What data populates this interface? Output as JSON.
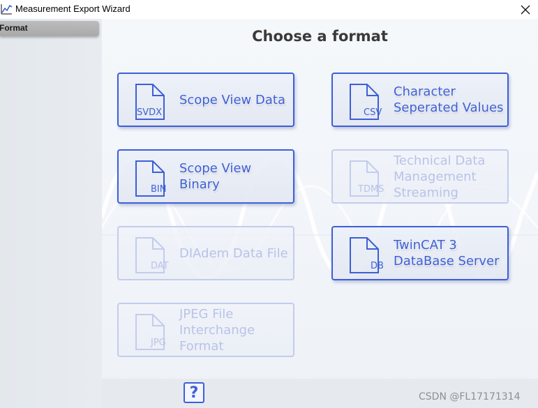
{
  "window": {
    "title": "Measurement Export Wizard",
    "app_icon": "chart-line-icon",
    "close_icon": "close-icon"
  },
  "sidebar": {
    "items": [
      {
        "label": "Format",
        "selected": true
      }
    ]
  },
  "main": {
    "heading": "Choose a format",
    "formats": [
      {
        "ext": "SVDX",
        "label": "Scope View Data",
        "enabled": true,
        "icon": "document-icon"
      },
      {
        "ext": "CSV",
        "label": "Character\nSeperated Values",
        "enabled": true,
        "icon": "document-icon"
      },
      {
        "ext": "BIN",
        "label": "Scope View Binary",
        "enabled": true,
        "icon": "document-icon"
      },
      {
        "ext": "TDMS",
        "label": "Technical Data\nManagement\nStreaming",
        "enabled": false,
        "icon": "document-icon"
      },
      {
        "ext": "DAT",
        "label": "DIAdem Data File",
        "enabled": false,
        "icon": "document-icon"
      },
      {
        "ext": "DB",
        "label": "TwinCAT 3\nDataBase Server",
        "enabled": true,
        "icon": "document-icon"
      },
      {
        "ext": "JPG",
        "label": "JPEG File\nInterchange\nFormat",
        "enabled": false,
        "icon": "document-icon"
      }
    ]
  },
  "footer": {
    "help_label": "?",
    "watermark": "CSDN @FL17171314"
  },
  "colors": {
    "accent": "#3d5fd6",
    "disabled": "#b9c3e8",
    "sidebar_selected": "#b0b0b0"
  }
}
